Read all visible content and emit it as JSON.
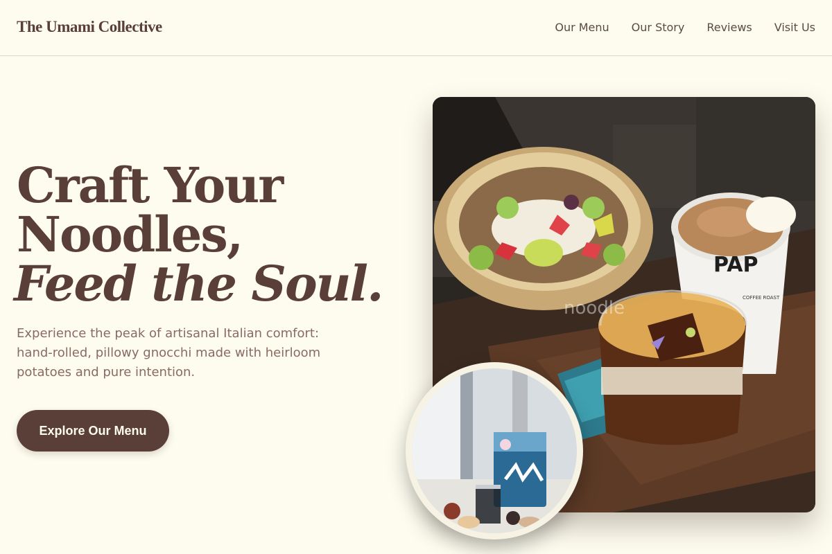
{
  "header": {
    "brand": "The Umami Collective",
    "nav": [
      "Our Menu",
      "Our Story",
      "Reviews",
      "Visit Us"
    ]
  },
  "hero": {
    "headline_line1": "Craft Your",
    "headline_line2": "Noodles,",
    "headline_line3": "Feed the Soul.",
    "subtitle": "Experience the peak of artisanal Italian comfort: hand-rolled, pillowy gnocchi made with heirloom potatoes and pure intention.",
    "cta_label": "Explore Our Menu"
  },
  "main_image": {
    "cup_text": "PAP",
    "cup_subtext": "COFFEE ROAST",
    "watermark": "noodle"
  },
  "colors": {
    "background": "#fdfcef",
    "brand_brown": "#5a3e38",
    "subtitle": "#8a6a62"
  }
}
